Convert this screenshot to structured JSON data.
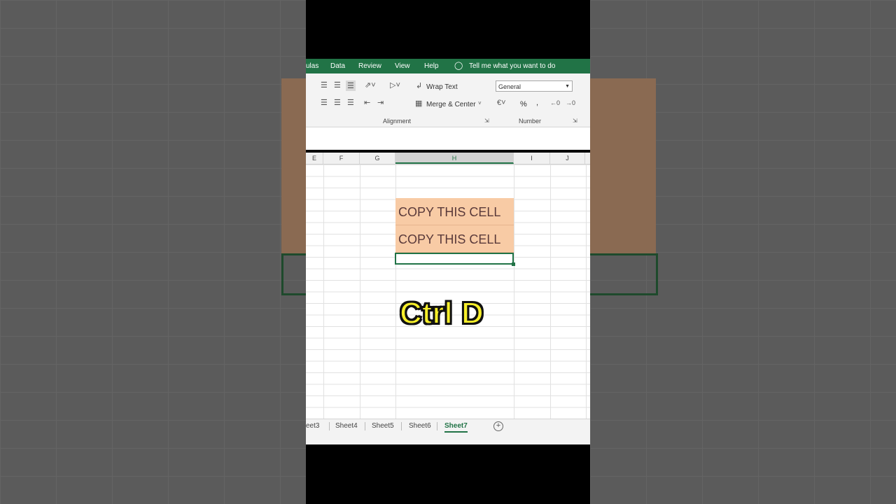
{
  "ribbon_tabs": [
    "ulas",
    "Data",
    "Review",
    "View",
    "Help",
    "Tell me what you want to do"
  ],
  "ribbon": {
    "wrap_text": "Wrap Text",
    "merge_center": "Merge & Center",
    "number_format": "General",
    "group_alignment": "Alignment",
    "group_number": "Number",
    "percent": "%",
    "comma": ","
  },
  "columns": [
    "E",
    "F",
    "G",
    "H",
    "I",
    "J"
  ],
  "cells": {
    "h1": "COPY THIS CELL",
    "h2": "COPY THIS CELL"
  },
  "overlay_text": "Ctrl D",
  "sheets": [
    "eet3",
    "Sheet4",
    "Sheet5",
    "Sheet6",
    "Sheet7"
  ],
  "active_sheet": "Sheet7",
  "colors": {
    "accent": "#217346",
    "cell_fill": "#f8cba5",
    "overlay": "#f7ef2a"
  }
}
